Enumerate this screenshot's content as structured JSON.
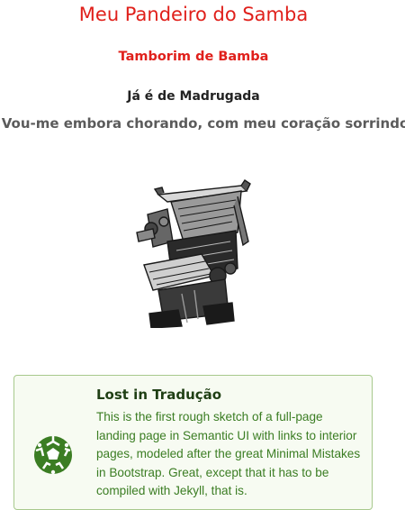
{
  "header": {
    "title": "Meu Pandeiro do Samba",
    "subtitle": "Tamborim de Bamba",
    "heading": "Já é de Madrugada",
    "tagline": "Vou-me embora chorando, com meu coração sorrindo"
  },
  "illustration": {
    "icon": "linotype-machine-engraving"
  },
  "card": {
    "icon": "soccer-ball-icon",
    "accent_color": "#3b7d23",
    "title": "Lost in Tradução",
    "body": "This is the first rough sketch of a full-page landing page in Semantic UI with links to interior pages, modeled after the great Minimal Mistakes in Bootstrap. Great, except that it has to be compiled with Jekyll, that is."
  }
}
